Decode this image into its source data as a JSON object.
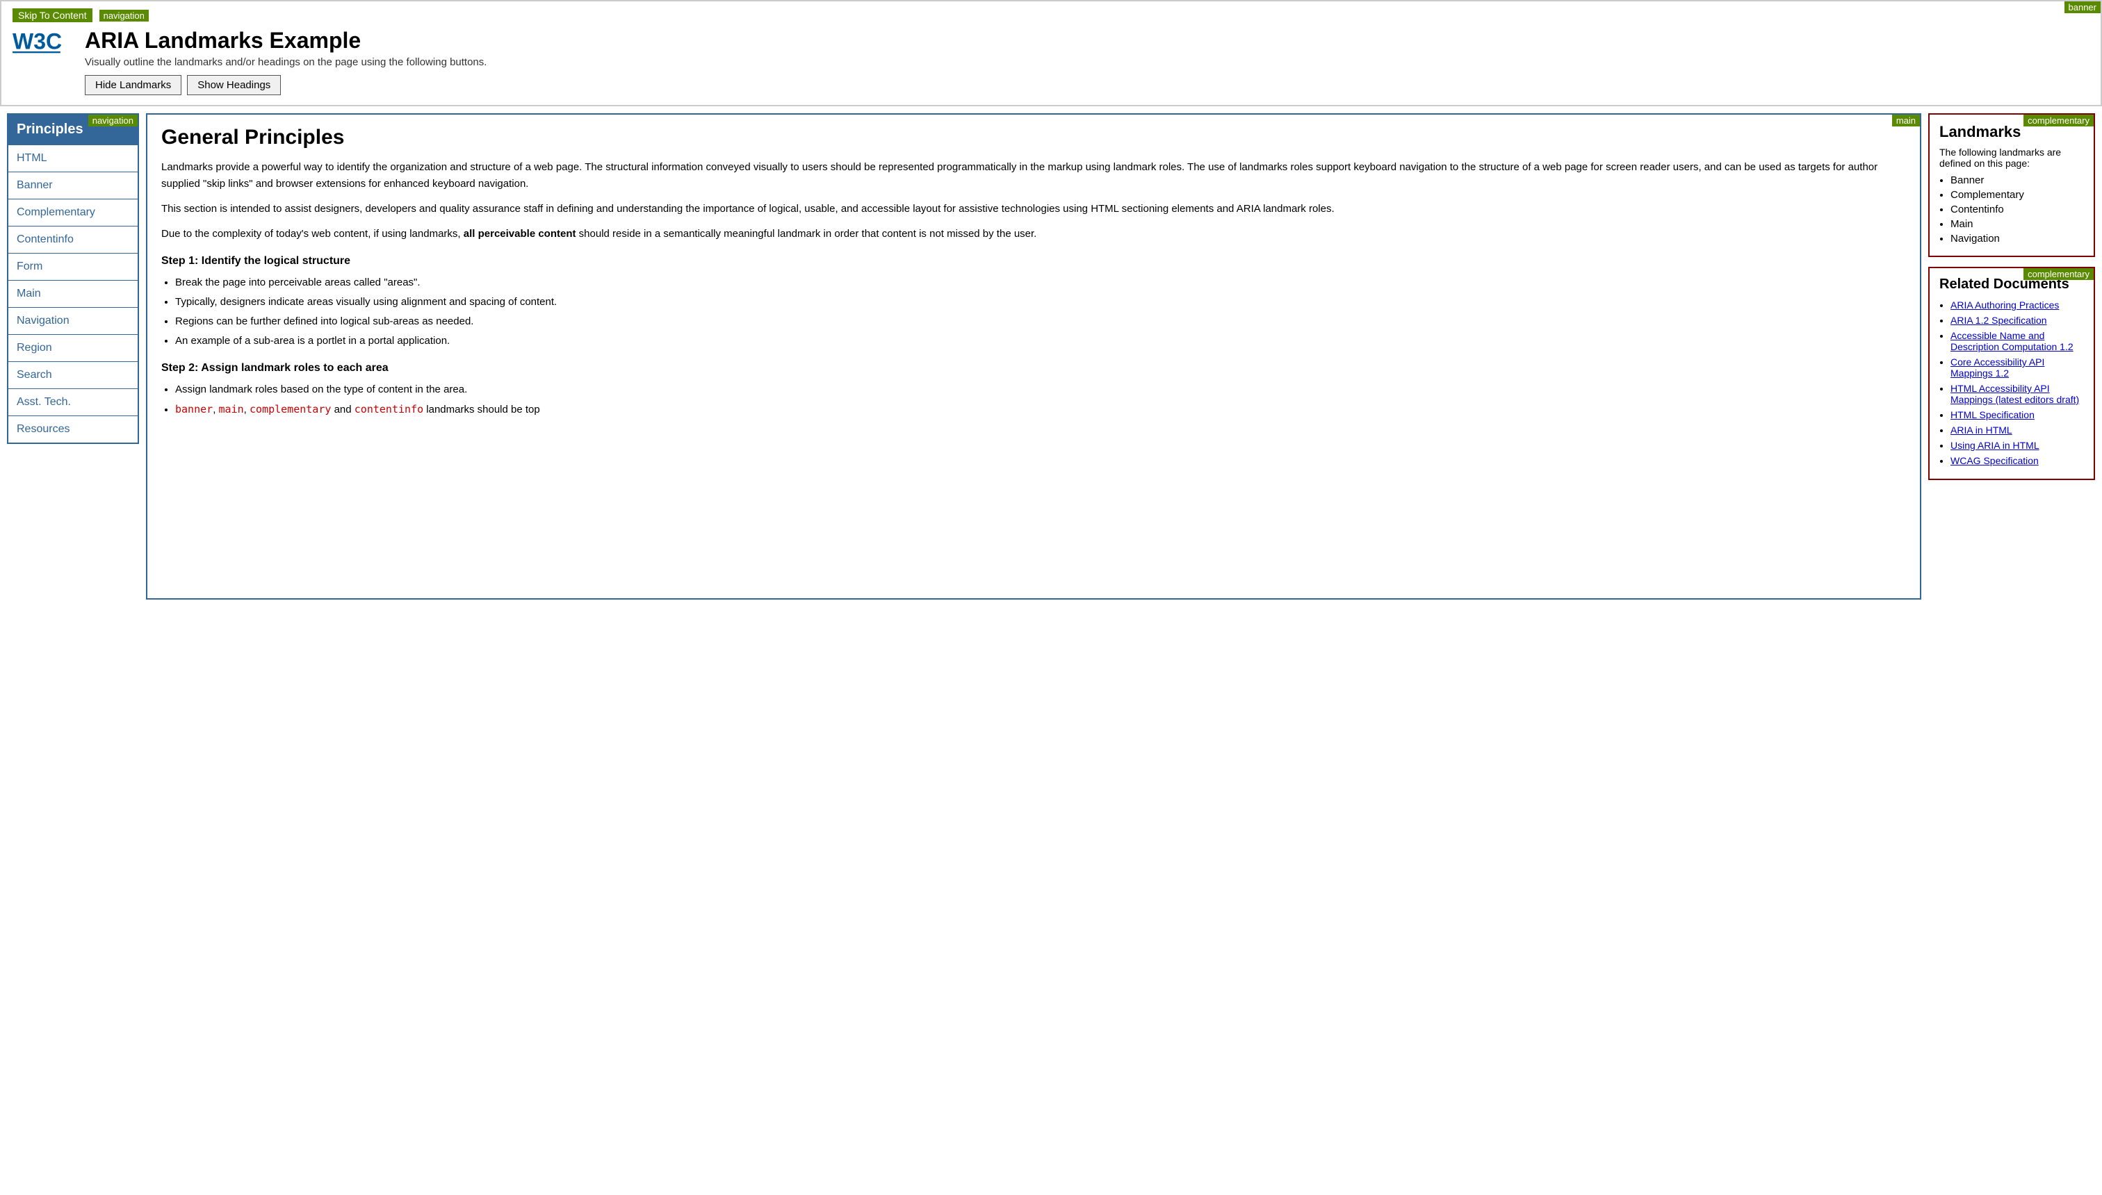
{
  "header": {
    "skip_label": "Skip To Content",
    "nav_label": "navigation",
    "banner_label": "banner",
    "title": "ARIA Landmarks Example",
    "subtitle": "Visually outline the landmarks and/or headings on the page using the following buttons.",
    "btn_hide_landmarks": "Hide Landmarks",
    "btn_show_headings": "Show Headings"
  },
  "sidebar": {
    "nav_label": "navigation",
    "header_item": "Principles",
    "items": [
      {
        "label": "HTML"
      },
      {
        "label": "Banner"
      },
      {
        "label": "Complementary"
      },
      {
        "label": "Contentinfo"
      },
      {
        "label": "Form"
      },
      {
        "label": "Main"
      },
      {
        "label": "Navigation"
      },
      {
        "label": "Region"
      },
      {
        "label": "Search"
      },
      {
        "label": "Asst. Tech."
      },
      {
        "label": "Resources"
      }
    ]
  },
  "main": {
    "main_label": "main",
    "heading": "General Principles",
    "para1": "Landmarks provide a powerful way to identify the organization and structure of a web page. The structural information conveyed visually to users should be represented programmatically in the markup using landmark roles. The use of landmarks roles support keyboard navigation to the structure of a web page for screen reader users, and can be used as targets for author supplied \"skip links\" and browser extensions for enhanced keyboard navigation.",
    "para2": "This section is intended to assist designers, developers and quality assurance staff in defining and understanding the importance of logical, usable, and accessible layout for assistive technologies using HTML sectioning elements and ARIA landmark roles.",
    "para3_before": "Due to the complexity of today's web content, if using landmarks, ",
    "para3_bold": "all perceivable content",
    "para3_after": " should reside in a semantically meaningful landmark in order that content is not missed by the user.",
    "step1_heading": "Step 1: Identify the logical structure",
    "step1_bullets": [
      "Break the page into perceivable areas called \"areas\".",
      "Typically, designers indicate areas visually using alignment and spacing of content.",
      "Regions can be further defined into logical sub-areas as needed.",
      "An example of a sub-area is a portlet in a portal application."
    ],
    "step2_heading": "Step 2: Assign landmark roles to each area",
    "step2_bullets": [
      "Assign landmark roles based on the type of content in the area.",
      "banner , main , complementary and contentinfo landmarks should be top"
    ],
    "step2_bullet_code": [
      "banner",
      "main",
      "complementary",
      "contentinfo"
    ]
  },
  "landmarks_panel": {
    "label": "complementary",
    "heading": "Landmarks",
    "subtext": "The following landmarks are defined on this page:",
    "items": [
      "Banner",
      "Complementary",
      "Contentinfo",
      "Main",
      "Navigation"
    ]
  },
  "related_panel": {
    "label": "complementary",
    "heading": "Related Documents",
    "links": [
      "ARIA Authoring Practices",
      "ARIA 1.2 Specification",
      "Accessible Name and Description Computation 1.2",
      "Core Accessibility API Mappings 1.2",
      "HTML Accessibility API Mappings (latest editors draft)",
      "HTML Specification",
      "ARIA in HTML",
      "Using ARIA in HTML",
      "WCAG Specification"
    ]
  }
}
